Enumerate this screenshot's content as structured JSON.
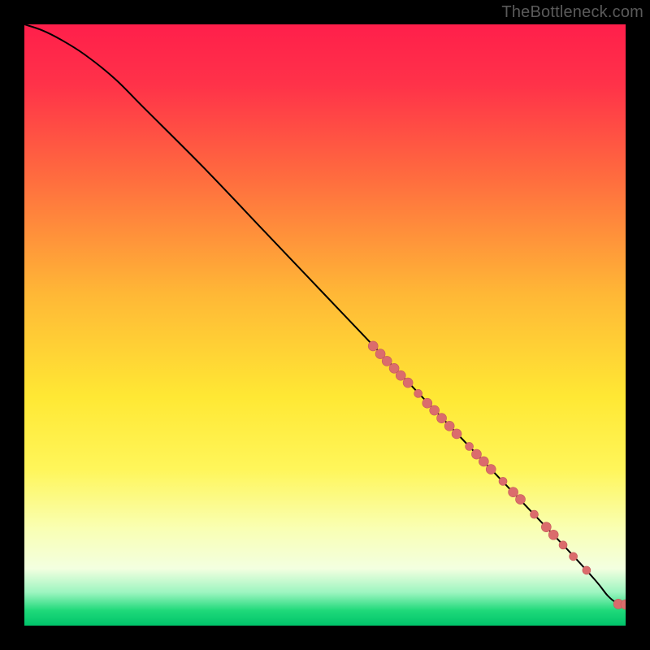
{
  "attribution": "TheBottleneck.com",
  "gradient_stops": [
    {
      "offset": 0.0,
      "color": "#ff1f4b"
    },
    {
      "offset": 0.1,
      "color": "#ff3249"
    },
    {
      "offset": 0.25,
      "color": "#ff6a3f"
    },
    {
      "offset": 0.45,
      "color": "#ffb836"
    },
    {
      "offset": 0.62,
      "color": "#ffe834"
    },
    {
      "offset": 0.74,
      "color": "#fff65a"
    },
    {
      "offset": 0.84,
      "color": "#f9ffb4"
    },
    {
      "offset": 0.905,
      "color": "#f3ffe0"
    },
    {
      "offset": 0.945,
      "color": "#9cf5c0"
    },
    {
      "offset": 0.975,
      "color": "#1fd97a"
    },
    {
      "offset": 1.0,
      "color": "#00c46a"
    }
  ],
  "marker_color": "#db6c6c",
  "marker_stroke": "#c45a5a",
  "curve_color": "#000000",
  "chart_data": {
    "type": "line",
    "title": "",
    "xlabel": "",
    "ylabel": "",
    "xlim": [
      0,
      100
    ],
    "ylim": [
      0,
      100
    ],
    "series": [
      {
        "name": "curve",
        "x": [
          0,
          3,
          6,
          10,
          15,
          20,
          30,
          40,
          50,
          60,
          70,
          80,
          90,
          95,
          97,
          98.5,
          100
        ],
        "y": [
          100,
          99,
          97.5,
          95,
          91,
          86,
          76,
          65.5,
          55,
          44.5,
          34,
          23.5,
          13,
          7.5,
          5,
          3.8,
          3.5
        ]
      }
    ],
    "markers": [
      {
        "x": 58.0,
        "y": 46.5,
        "r": 6
      },
      {
        "x": 59.2,
        "y": 45.2,
        "r": 6
      },
      {
        "x": 60.3,
        "y": 44.0,
        "r": 6
      },
      {
        "x": 61.5,
        "y": 42.8,
        "r": 6
      },
      {
        "x": 62.6,
        "y": 41.6,
        "r": 6
      },
      {
        "x": 63.8,
        "y": 40.4,
        "r": 6
      },
      {
        "x": 65.5,
        "y": 38.6,
        "r": 5
      },
      {
        "x": 67.0,
        "y": 37.0,
        "r": 6
      },
      {
        "x": 68.2,
        "y": 35.8,
        "r": 6
      },
      {
        "x": 69.4,
        "y": 34.5,
        "r": 6
      },
      {
        "x": 70.7,
        "y": 33.2,
        "r": 6
      },
      {
        "x": 71.9,
        "y": 31.9,
        "r": 6
      },
      {
        "x": 74.0,
        "y": 29.8,
        "r": 5
      },
      {
        "x": 75.2,
        "y": 28.5,
        "r": 6
      },
      {
        "x": 76.4,
        "y": 27.3,
        "r": 6
      },
      {
        "x": 77.6,
        "y": 26.0,
        "r": 6
      },
      {
        "x": 79.6,
        "y": 24.0,
        "r": 5
      },
      {
        "x": 81.3,
        "y": 22.2,
        "r": 6
      },
      {
        "x": 82.5,
        "y": 21.0,
        "r": 6
      },
      {
        "x": 84.8,
        "y": 18.5,
        "r": 5
      },
      {
        "x": 86.8,
        "y": 16.4,
        "r": 6
      },
      {
        "x": 88.0,
        "y": 15.1,
        "r": 6
      },
      {
        "x": 89.6,
        "y": 13.4,
        "r": 5
      },
      {
        "x": 91.3,
        "y": 11.5,
        "r": 5
      },
      {
        "x": 93.5,
        "y": 9.2,
        "r": 5
      },
      {
        "x": 98.8,
        "y": 3.6,
        "r": 6
      },
      {
        "x": 100.0,
        "y": 3.5,
        "r": 6
      }
    ]
  }
}
